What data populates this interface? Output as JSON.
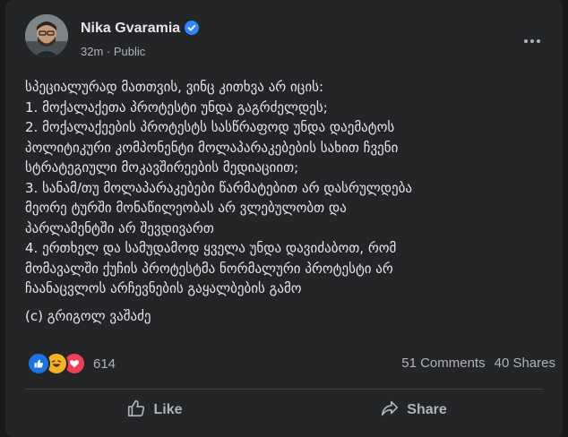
{
  "post": {
    "author": "Nika Gvaramia",
    "verified_icon": "verified-badge-icon",
    "time": "32m",
    "separator": "·",
    "audience": "Public",
    "more_icon": "more-options-icon",
    "text_lines": [
      "სპეციალურად მათთვის, ვინც კითხვა არ იცის:",
      " 1. მოქალაქეთა პროტესტი უნდა გაგრძელდეს;",
      " 2. მოქალაქეების პროტესტს სასწრაფოდ უნდა დაემატოს",
      "პოლიტიკური კომპონენტი მოლაპარაკებების სახით ჩვენი",
      "სტრატეგიული მოკავშირეების მედიაციით;",
      " 3. სანამ/თუ მოლაპარაკებები წარმატებით არ დასრულდება",
      "მეორე ტურში მონაწილეობას არ ვლებულობთ და",
      "პარლამენტში არ შევდივართ",
      " 4. ერთხელ და სამუდამოდ ყველა უნდა დავიძაბოთ, რომ",
      "მომავალში ქუჩის პროტესტმა ნორმალური პროტესტი არ",
      "ჩაანაცვლოს არჩევნების გაყალბების გამო"
    ],
    "signature": "(c) გრიგოლ ვაშაძე"
  },
  "stats": {
    "reaction_icons": [
      "like-reaction-icon",
      "haha-reaction-icon",
      "love-reaction-icon"
    ],
    "reaction_count": "614",
    "comments": "51 Comments",
    "shares": "40 Shares"
  },
  "actions": {
    "like_label": "Like",
    "share_label": "Share"
  },
  "colors": {
    "background": "#18191a",
    "card": "#242526",
    "text": "#e4e6eb",
    "secondary": "#b0b3b8",
    "accent": "#1b74e4"
  }
}
